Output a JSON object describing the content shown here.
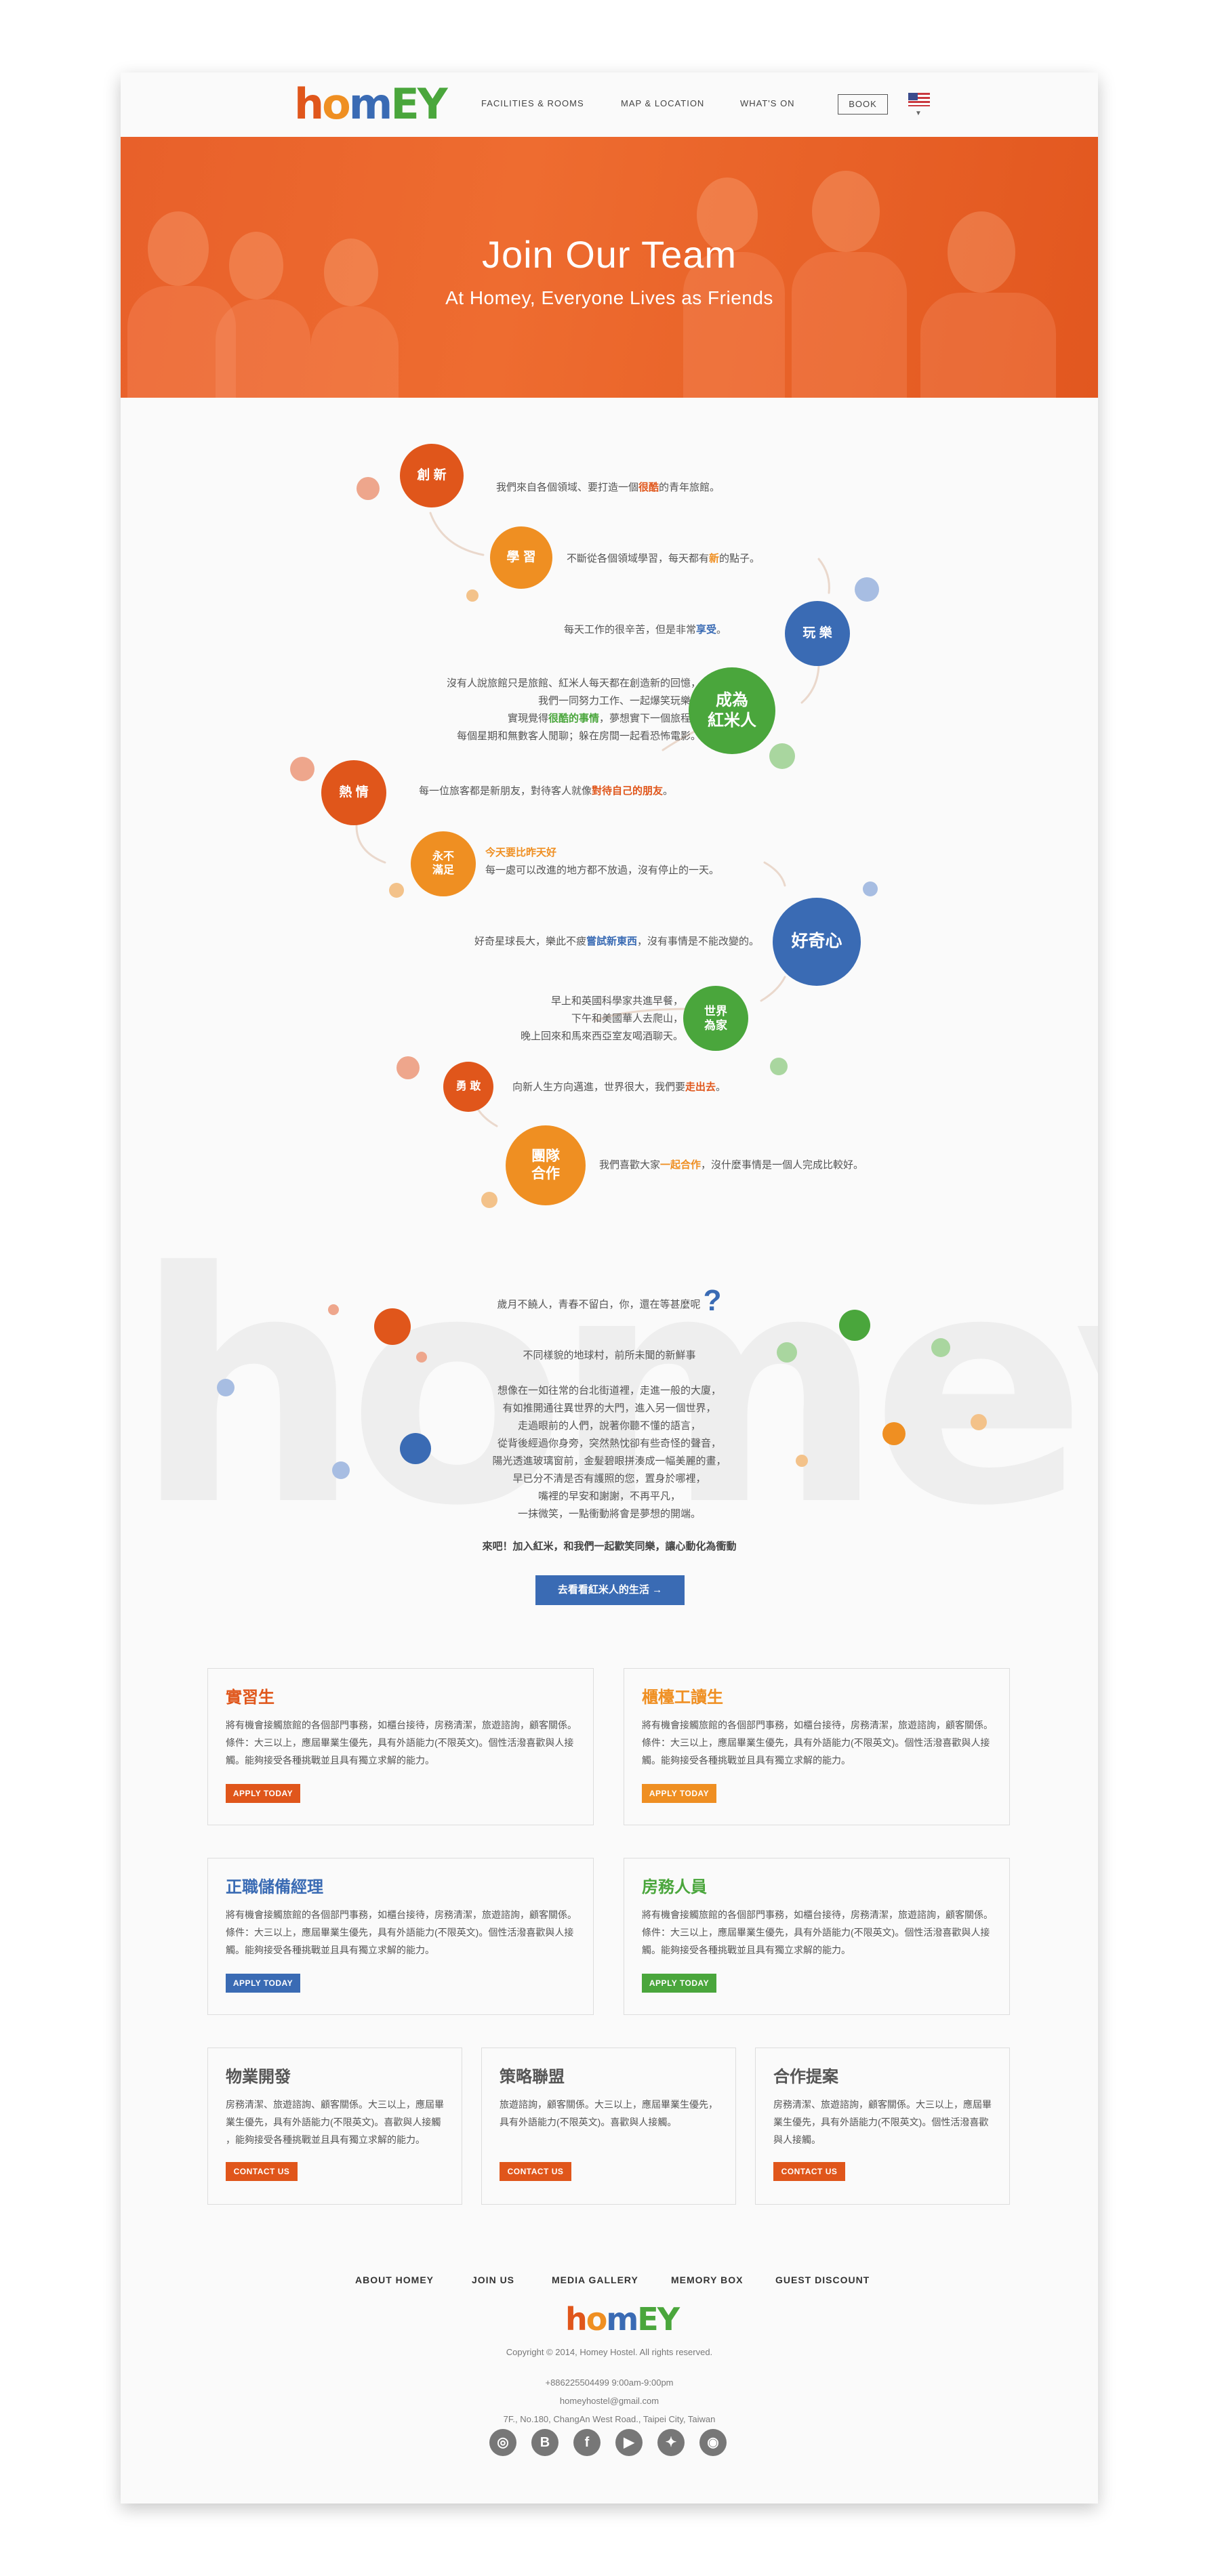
{
  "header": {
    "logo": "homey",
    "nav": [
      "FACILITIES & ROOMS",
      "MAP & LOCATION",
      "WHAT'S ON"
    ],
    "book": "BOOK"
  },
  "hero": {
    "title": "Join Our Team",
    "subtitle": "At Homey, Everyone Lives as Friends"
  },
  "values": [
    {
      "circle": "創 新",
      "pre": "我們來自各個領域、要打造一個",
      "hl": "很酷",
      "post": "的青年旅館。"
    },
    {
      "circle": "學 習",
      "pre": "不斷從各個領域學習，每天都有",
      "hl": "新",
      "post": "的點子。"
    },
    {
      "circle": "玩 樂",
      "pre": "每天工作的很辛苦，但是非常",
      "hl": "享受",
      "post": "。"
    },
    {
      "circle": "成為\n紅米人",
      "lines": [
        "沒有人說旅館只是旅館、紅米人每天都在創造新的回憶，",
        "我們一同努力工作、一起爆笑玩樂，",
        "每個星期和無數客人閒聊；躲在房間一起看恐怖電影。"
      ],
      "line3_pre": "實現覺得",
      "line3_hl": "很酷的事情",
      "line3_post": "，夢想實下一個旅程。"
    },
    {
      "circle": "熱 情",
      "pre": "每一位旅客都是新朋友，對待客人就像",
      "hl": "對待自己的朋友",
      "post": "。"
    },
    {
      "circle": "永不\n滿足",
      "hl": "今天要比昨天好",
      "line2": "每一處可以改進的地方都不放過，沒有停止的一天。"
    },
    {
      "circle": "好奇心",
      "pre": "好奇星球長大，樂此不疲",
      "hl": "嘗試新東西",
      "post": "，沒有事情是不能改變的。"
    },
    {
      "circle": "世界\n為家",
      "lines": [
        "早上和英國科學家共進早餐，",
        "下午和美國華人去爬山，",
        "晚上回來和馬來西亞室友喝酒聊天。"
      ]
    },
    {
      "circle": "勇 敢",
      "pre": "向新人生方向邁進，世界很大，我們要",
      "hl": "走出去",
      "post": "。"
    },
    {
      "circle": "團隊\n合作",
      "pre": "我們喜歡大家",
      "hl": "一起合作",
      "post": "，沒什麼事情是一個人完成比較好。"
    }
  ],
  "story": {
    "bigword": "homey",
    "question": "歲月不饒人，青春不留白，你，還在等甚麼呢",
    "qmark": "?",
    "intro": "不同樣貌的地球村，前所未聞的新鮮事",
    "lines": [
      "想像在一如往常的台北街道裡，走進一般的大廈，",
      "有如推開通往異世界的大門，進入另一個世界，",
      "走過眼前的人們，說著你聽不懂的語言，",
      "從背後經過你身旁，突然熱忱卻有些奇怪的聲音，",
      "陽光透進玻璃窗前，金髮碧眼拼湊成一幅美麗的畫，",
      "早已分不清是否有護照的您，置身於哪裡，",
      "嘴裡的早安和謝謝，不再平凡，",
      "一抹微笑，一點衝動將會是夢想的開端。"
    ],
    "closing": "來吧！加入紅米，和我們一起歡笑同樂，讓心動化為衝動",
    "cta": "去看看紅米人的生活 →"
  },
  "jobs": [
    {
      "title": "實習生",
      "desc": [
        "將有機會接觸旅館的各個部門事務，如櫃台接待，房務清潔，旅遊諮詢，顧客關係。",
        "條件：大三以上，應屆畢業生優先，具有外語能力(不限英文)。個性活潑喜歡與人接",
        "觸。能夠接受各種挑戰並且具有獨立求解的能力。"
      ],
      "button": "APPLY TODAY",
      "color": "#e0561b"
    },
    {
      "title": "櫃檯工讀生",
      "desc": [
        "將有機會接觸旅館的各個部門事務，如櫃台接待，房務清潔，旅遊諮詢，顧客關係。",
        "條件：大三以上，應屆畢業生優先，具有外語能力(不限英文)。個性活潑喜歡與人接",
        "觸。能夠接受各種挑戰並且具有獨立求解的能力。"
      ],
      "button": "APPLY TODAY",
      "color": "#ef8f22"
    },
    {
      "title": "正職儲備經理",
      "desc": [
        "將有機會接觸旅館的各個部門事務，如櫃台接待，房務清潔，旅遊諮詢，顧客關係。",
        "條件：大三以上，應屆畢業生優先，具有外語能力(不限英文)。個性活潑喜歡與人接",
        "觸。能夠接受各種挑戰並且具有獨立求解的能力。"
      ],
      "button": "APPLY TODAY",
      "color": "#3a6bb4"
    },
    {
      "title": "房務人員",
      "desc": [
        "將有機會接觸旅館的各個部門事務，如櫃台接待，房務清潔，旅遊諮詢，顧客關係。",
        "條件：大三以上，應屆畢業生優先，具有外語能力(不限英文)。個性活潑喜歡與人接",
        "觸。能夠接受各種挑戰並且具有獨立求解的能力。"
      ],
      "button": "APPLY TODAY",
      "color": "#4aa63c"
    }
  ],
  "partners": [
    {
      "title": "物業開發",
      "desc": [
        "房務清潔、旅遊諮詢、顧客關係。大三以上，應屆畢",
        "業生優先，具有外語能力(不限英文)。喜歡與人接觸",
        "，能夠接受各種挑戰並且具有獨立求解的能力。"
      ],
      "button": "CONTACT US"
    },
    {
      "title": "策略聯盟",
      "desc": [
        "旅遊諮詢，顧客關係。大三以上，應屆畢業生優先，",
        "具有外語能力(不限英文)。喜歡與人接觸。"
      ],
      "button": "CONTACT US"
    },
    {
      "title": "合作提案",
      "desc": [
        "房務清潔、旅遊諮詢，顧客關係。大三以上，應屆畢",
        "業生優先，具有外語能力(不限英文)。個性活潑喜歡",
        "與人接觸。"
      ],
      "button": "CONTACT US"
    }
  ],
  "footer": {
    "nav": [
      "ABOUT HOMEY",
      "JOIN US",
      "MEDIA GALLERY",
      "MEMORY BOX",
      "GUEST DISCOUNT"
    ],
    "logo": "homey",
    "copyright": "Copyright © 2014, Homey Hostel. All rights reserved.",
    "phone": "+886225504499   9:00am-9:00pm",
    "email": "homeyhostel@gmail.com",
    "address": "7F., No.180, ChangAn West Road., Taipei City, Taiwan",
    "social": [
      {
        "icon": "tripadvisor-icon",
        "glyph": "◎"
      },
      {
        "icon": "blogger-icon",
        "glyph": "B"
      },
      {
        "icon": "facebook-icon",
        "glyph": "f"
      },
      {
        "icon": "youtube-icon",
        "glyph": "▶"
      },
      {
        "icon": "twitter-icon",
        "glyph": "✦"
      },
      {
        "icon": "weibo-icon",
        "glyph": "◉"
      }
    ]
  },
  "colors": {
    "orange": "#e0561b",
    "amber": "#ef8f22",
    "blue": "#3a6bb4",
    "green": "#4aa63c"
  }
}
